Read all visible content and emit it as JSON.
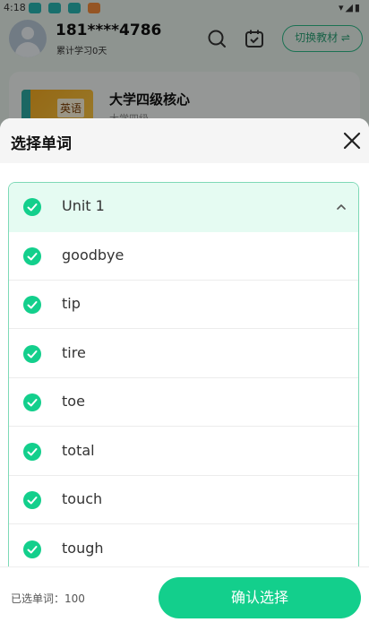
{
  "status_bar": {
    "time": "4:18"
  },
  "background": {
    "user_phone": "181****4786",
    "study_days": "累计学习0天",
    "switch_label": "切换教材 ⇌",
    "book_title": "大学四级核心",
    "book_subtitle": "大学四级",
    "book_cover_text": "英语"
  },
  "sheet": {
    "title": "选择单词",
    "unit": {
      "label": "Unit 1",
      "checked": true,
      "expanded": true
    },
    "words": [
      {
        "label": "goodbye",
        "checked": true
      },
      {
        "label": "tip",
        "checked": true
      },
      {
        "label": "tire",
        "checked": true
      },
      {
        "label": "toe",
        "checked": true
      },
      {
        "label": "total",
        "checked": true
      },
      {
        "label": "touch",
        "checked": true
      },
      {
        "label": "tough",
        "checked": true
      }
    ],
    "footer": {
      "selected_text": "已选单词：100",
      "confirm_label": "确认选择"
    }
  },
  "colors": {
    "accent": "#13cf8c",
    "unit_bg": "#e5fbf2",
    "border": "#7ed9b7"
  }
}
